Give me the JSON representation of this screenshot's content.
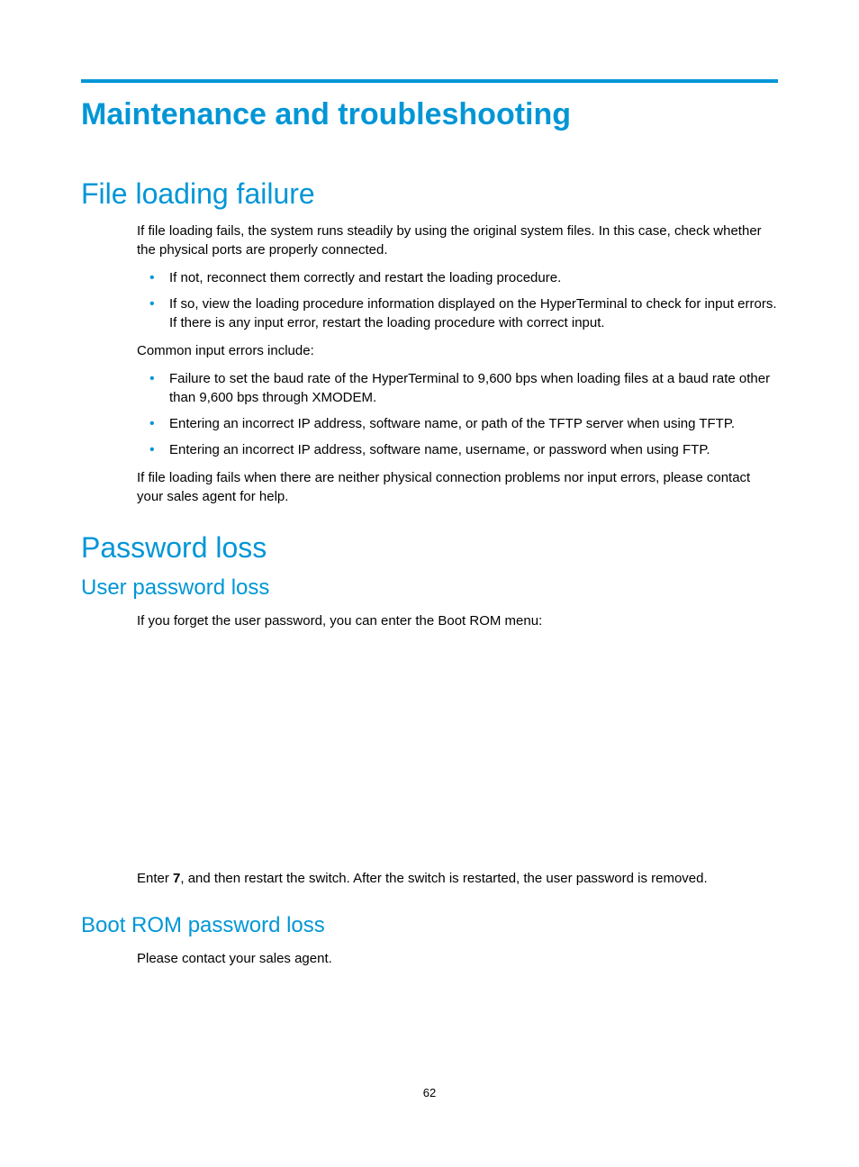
{
  "title": "Maintenance and troubleshooting",
  "sections": {
    "file_loading": {
      "heading": "File loading failure",
      "intro": "If file loading fails, the system runs steadily by using the original system files. In this case, check whether the physical ports are properly connected.",
      "bullets1": [
        "If not, reconnect them correctly and restart the loading procedure.",
        "If so, view the loading procedure information displayed on the HyperTerminal to check for input errors. If there is any input error, restart the loading procedure with correct input."
      ],
      "common_errors_intro": "Common input errors include:",
      "bullets2": [
        "Failure to set the baud rate of the HyperTerminal to 9,600 bps when loading files at a baud rate other than 9,600 bps through XMODEM.",
        "Entering an incorrect IP address, software name, or path of the TFTP server when using TFTP.",
        "Entering an incorrect IP address, software name, username, or password when using FTP."
      ],
      "closing": "If file loading fails when there are neither physical connection problems nor input errors, please contact your sales agent for help."
    },
    "password_loss": {
      "heading": "Password loss",
      "user_pw": {
        "heading": "User password loss",
        "intro": "If you forget the user password, you can enter the Boot ROM menu:",
        "after_prefix": "Enter ",
        "after_bold": "7",
        "after_suffix": ", and then restart the switch. After the switch is restarted, the user password is removed."
      },
      "boot_rom": {
        "heading": "Boot ROM password loss",
        "body": "Please contact your sales agent."
      }
    }
  },
  "page_number": "62"
}
